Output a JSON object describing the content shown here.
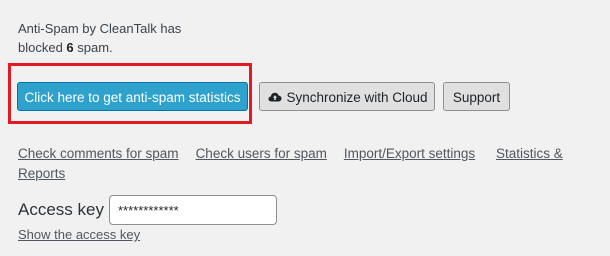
{
  "summary": {
    "prefix": "Anti-Spam by CleanTalk has blocked ",
    "count": "6",
    "suffix": " spam."
  },
  "buttons": {
    "statistics": "Click here to get anti-spam statistics",
    "sync": "Synchronize with Cloud",
    "support": "Support"
  },
  "icons": {
    "sync_icon": "cloud-upload-icon"
  },
  "links": [
    "Check comments for spam",
    "Check users for spam",
    "Import/Export settings",
    "Statistics & Reports"
  ],
  "access_key": {
    "label": "Access key",
    "value": "************",
    "show_link": "Show the access key"
  },
  "colors": {
    "highlight": "#e01b24",
    "primary_button": "#2ea2cc"
  }
}
